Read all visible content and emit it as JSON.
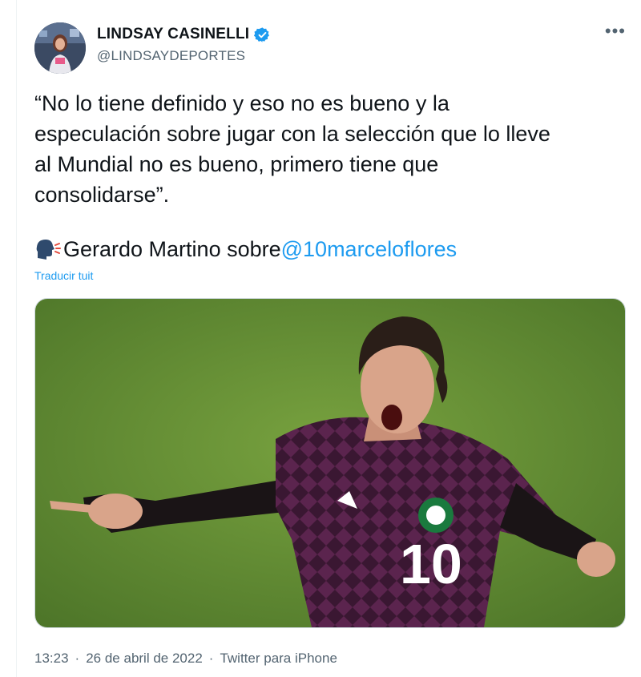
{
  "author": {
    "name": "LINDSAY CASINELLI",
    "handle": "@LINDSAYDEPORTES",
    "verified": true
  },
  "tweet": {
    "text_lines": [
      "“No lo tiene definido y eso no es bueno y la",
      "especulación sobre jugar con la selección que lo lleve",
      "al Mundial no es bueno, primero tiene que",
      "consolidarse”."
    ],
    "quote_prefix": "Gerardo Martino sobre",
    "mention": "@10marceloflores",
    "translate_label": "Traducir tuit"
  },
  "media": {
    "jersey_number": "10"
  },
  "meta": {
    "time": "13:23",
    "date": "26 de abril de 2022",
    "source": "Twitter para iPhone"
  },
  "colors": {
    "link": "#1d9bf0",
    "secondary_text": "#536471",
    "jersey": "#4a1f3f",
    "pitch": "#5f8a35"
  },
  "icons": [
    "verified-badge-icon",
    "more-options-icon",
    "speaking-head-icon"
  ]
}
